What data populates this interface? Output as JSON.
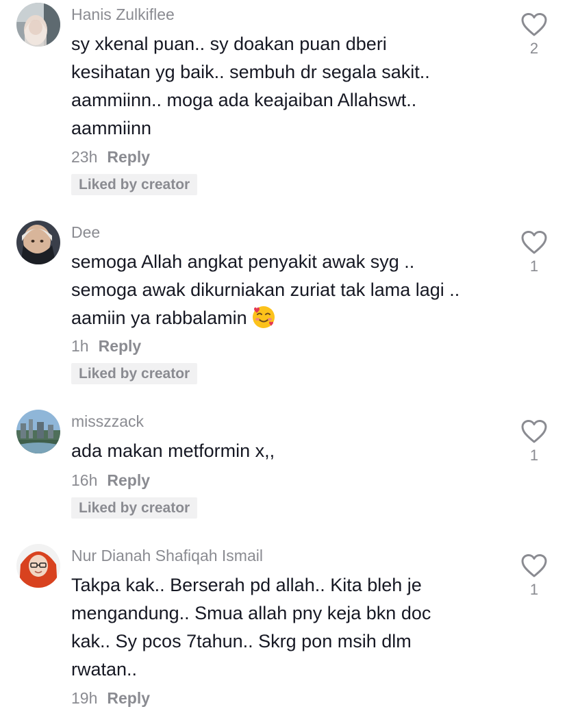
{
  "comments": [
    {
      "username": "Hanis Zulkiflee",
      "lines": [
        "sy xkenal puan.. sy doakan puan dberi",
        "kesihatan yg baik.. sembuh dr segala sakit..",
        "aammiinn.. moga ada keajaiban Allahswt..",
        "aammiinn"
      ],
      "time": "23h",
      "reply_label": "Reply",
      "liked_label": "Liked by creator",
      "likes": "2"
    },
    {
      "username": "Dee",
      "lines": [
        "semoga Allah angkat penyakit awak syg ..",
        "semoga awak dikurniakan zuriat tak lama lagi ..",
        "aamiin ya rabbalamin"
      ],
      "emoji": "smiling-face-with-hearts",
      "time": "1h",
      "reply_label": "Reply",
      "liked_label": "Liked by creator",
      "likes": "1"
    },
    {
      "username": "misszzack",
      "lines": [
        "ada makan metformin x,,"
      ],
      "time": "16h",
      "reply_label": "Reply",
      "liked_label": "Liked by creator",
      "likes": "1"
    },
    {
      "username": "Nur Dianah Shafiqah Ismail",
      "lines": [
        "Takpa kak.. Berserah pd allah.. Kita bleh je",
        "mengandung.. Smua allah pny keja bkn doc",
        "kak.. Sy pcos 7tahun.. Skrg pon msih dlm",
        "rwatan.."
      ],
      "time": "19h",
      "reply_label": "Reply",
      "likes": "1"
    }
  ],
  "icons": {
    "like": "heart-outline-icon"
  },
  "colors": {
    "text": "#161823",
    "secondary": "#8a8b91",
    "badge_bg": "#f1f1f2"
  }
}
